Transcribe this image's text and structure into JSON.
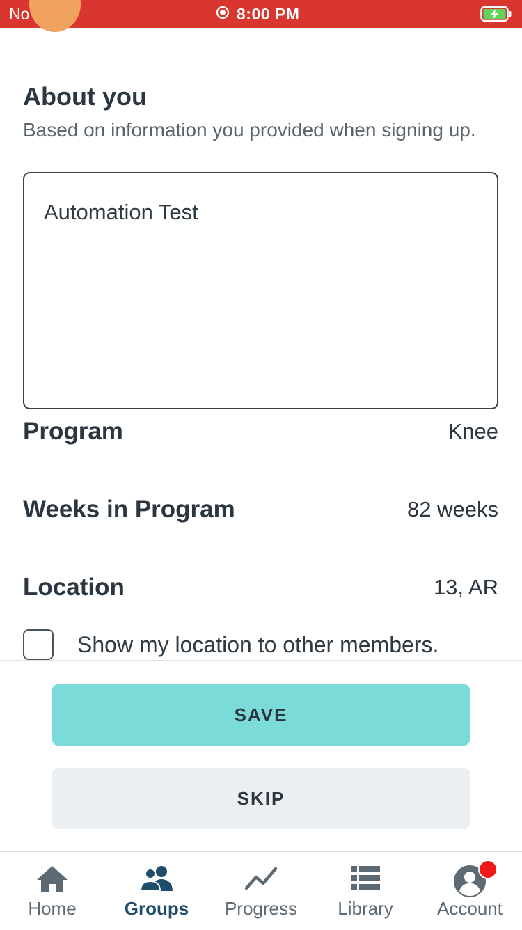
{
  "status_bar": {
    "carrier": "No SIM",
    "time": "8:00 PM",
    "background": "#d9362f"
  },
  "about": {
    "title": "About you",
    "subtitle": "Based on information you provided when signing up.",
    "bio_text": "Automation Test"
  },
  "info": {
    "program_label": "Program",
    "program_value": "Knee",
    "weeks_label": "Weeks in Program",
    "weeks_value": "82 weeks",
    "location_label": "Location",
    "location_value": "13, AR"
  },
  "location_toggle": {
    "label": "Show my location to other members.",
    "checked": false
  },
  "actions": {
    "save_label": "SAVE",
    "skip_label": "SKIP",
    "save_color": "#7bdbd9"
  },
  "tab_bar": {
    "tabs": [
      {
        "label": "Home",
        "icon": "home-icon"
      },
      {
        "label": "Groups",
        "icon": "groups-icon",
        "active": true
      },
      {
        "label": "Progress",
        "icon": "progress-icon"
      },
      {
        "label": "Library",
        "icon": "library-icon"
      },
      {
        "label": "Account",
        "icon": "account-icon",
        "has_notification": true
      }
    ],
    "active_color": "#1e4e6b",
    "notification_color": "#f2191a"
  }
}
